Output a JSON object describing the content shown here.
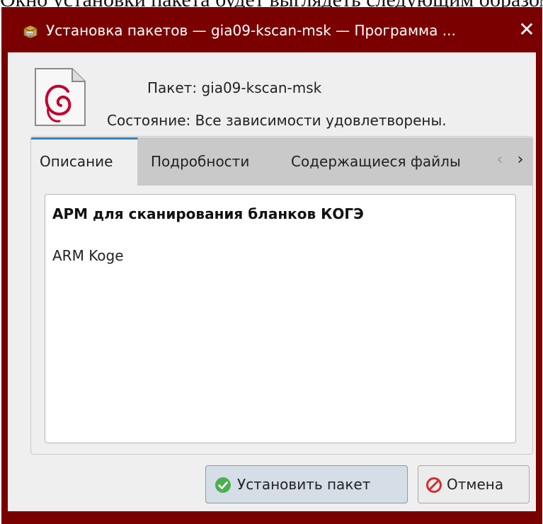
{
  "background_text": "Окно установки пакета будет выглядеть следующим образом:",
  "window": {
    "title": "Установка пакетов — gia09-kscan-msk — Программа ...",
    "title_icon": "deb-package-icon",
    "close_label": "✕"
  },
  "package": {
    "icon": "debian-swirl-icon",
    "name_label": "Пакет:",
    "name_value": "gia09-kscan-msk",
    "status_label": "Состояние:",
    "status_value": "Все зависимости удовлетворены."
  },
  "tabs": [
    {
      "label": "Описание",
      "active": true
    },
    {
      "label": "Подробности",
      "active": false
    },
    {
      "label": "Содержащиеся файлы",
      "active": false
    }
  ],
  "tab_scroll": {
    "left": "‹",
    "right": "›"
  },
  "description": {
    "title": "АРМ для сканирования бланков КОГЭ",
    "body": "ARM Koge"
  },
  "buttons": {
    "install_label": "Установить пакет",
    "cancel_label": "Отмена"
  },
  "colors": {
    "titlebar": "#7a0000",
    "accent": "#3c7bb6",
    "install_icon": "#4caf50",
    "cancel_icon": "#d32f2f"
  }
}
